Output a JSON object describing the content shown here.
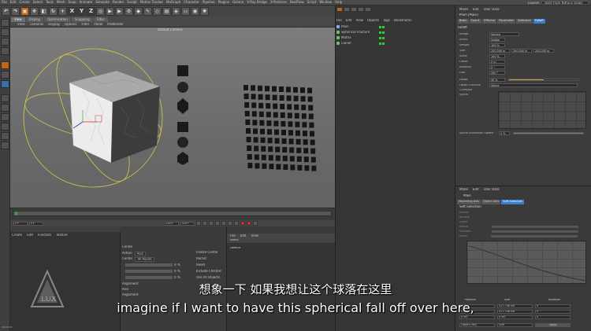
{
  "menubar": [
    "File",
    "Edit",
    "Create",
    "Select",
    "Tools",
    "Mesh",
    "Snap",
    "Animate",
    "Simulate",
    "Render",
    "Sculpt",
    "Motion Tracker",
    "MoGraph",
    "Character",
    "Pipeline",
    "Plugins",
    "Octane",
    "V-Ray Bridge",
    "X-Particles",
    "RealFlow",
    "Script",
    "Window",
    "Help"
  ],
  "layout": {
    "label": "Layout:",
    "value": "Start from Nitrous Down"
  },
  "toolbar": [
    "X",
    "Y",
    "Z"
  ],
  "viewport": {
    "tabs": [
      "View",
      "Display",
      "Optimisation",
      "Snapping",
      "Filter"
    ],
    "menu": [
      "View",
      "Cameras",
      "Display",
      "Options",
      "Filter",
      "Panel",
      "ProRender"
    ],
    "title": "Default Camera"
  },
  "transport": {
    "start": "0 F",
    "current": "0 F",
    "end": "120 F",
    "end2": "120 F"
  },
  "material_panel": {
    "menu": [
      "Create",
      "Edit",
      "Function",
      "Texture"
    ]
  },
  "coord_panel": {
    "rows": [
      "Center",
      "Action",
      "Center"
    ],
    "values": [
      "Axis",
      "All Points"
    ],
    "fields": [
      "0 %",
      "0 %",
      "0 %"
    ],
    "checks": [
      "Freeze Center",
      "Recalc",
      "Reset",
      "Include Children",
      "Use All Objects"
    ],
    "bottom": [
      "Alignment",
      "Axis",
      "Alignment"
    ]
  },
  "effector_panel": {
    "menu": [
      "File",
      "Edit",
      "View"
    ],
    "header": [
      "Name"
    ],
    "row": "Default"
  },
  "object_manager": {
    "menu": [
      "File",
      "Edit",
      "View",
      "Objects",
      "Tags",
      "Bookmarks"
    ],
    "objects": [
      {
        "name": "Plain",
        "color": "#7ab0e8"
      },
      {
        "name": "Spherical Fracture",
        "color": "#6bc06b"
      },
      {
        "name": "Matrix",
        "color": "#6bc06b"
      },
      {
        "name": "Cloner",
        "color": "#6bc06b"
      }
    ]
  },
  "attribute_manager": {
    "menu": [
      "Mode",
      "Edit",
      "User Data"
    ],
    "title": "Plain [Plain]",
    "tabs": [
      "Basic",
      "Coord.",
      "Effector",
      "Parameter",
      "Deformer",
      "Falloff"
    ],
    "section": "Falloff",
    "props": [
      {
        "label": "Shape",
        "value": "Sphere"
      },
      {
        "label": "Invert",
        "value": "Visible"
      },
      {
        "label": "Weight",
        "value": "100 %"
      },
      {
        "label": "Size",
        "value": "200.000 m"
      },
      {
        "label": "Scale",
        "value": "100 %"
      },
      {
        "label": "Offset",
        "value": "0 m"
      },
      {
        "label": "Rotation",
        "value": "0 °"
      },
      {
        "label": "Hue",
        "value": "200 °"
      }
    ],
    "falloff": {
      "label": "Falloff",
      "value": "50 %",
      "level": 0.5
    },
    "falloff_function": {
      "label": "Falloff Function",
      "value": "Spline"
    },
    "clamped": "Clamped",
    "spline": "Spline",
    "spline_speed": {
      "label": "Spline Animation Speed",
      "value": "0 %"
    }
  },
  "layer_manager": {
    "menu": [
      "Mode",
      "Edit",
      "User Data"
    ],
    "title": "Plain",
    "tabs": [
      "Modelling Axis",
      "Object Axis",
      "Soft Selection"
    ],
    "section": "Soft Selection",
    "rows": [
      "Enable",
      "Surface",
      "Falloff",
      "Radius",
      "Strength",
      "Width"
    ]
  },
  "coord_table": {
    "headers": [
      "Position",
      "Size",
      "Rotation"
    ],
    "rows": [
      [
        "0 cm",
        "417.796 cm",
        "0 °"
      ],
      [
        "0 cm",
        "417.796 cm",
        "0 °"
      ],
      [
        "0 cm",
        "0 cm",
        "0 °"
      ]
    ],
    "footer": [
      "Object (Rel)",
      "Size",
      "Apply"
    ]
  },
  "subtitles": {
    "cn": "想象一下 如果我想让这个球落在这里",
    "en": "imagine if I want to have this spherical fall off over here,"
  },
  "logo": "LUX",
  "status": "00:00:00"
}
